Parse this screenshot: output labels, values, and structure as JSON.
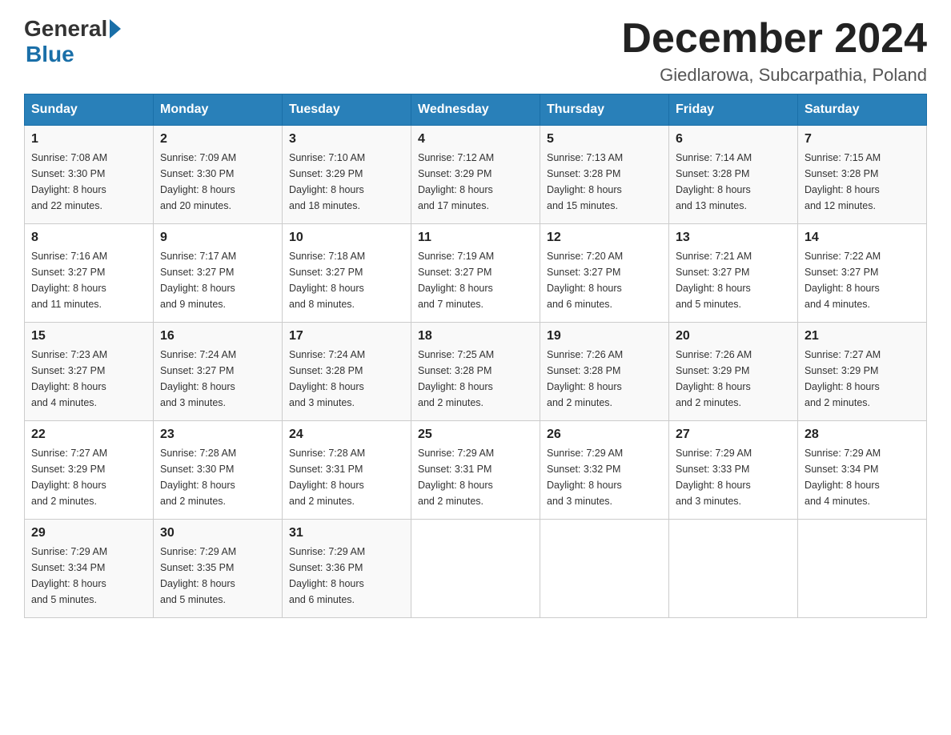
{
  "header": {
    "logo_general": "General",
    "logo_blue": "Blue",
    "month_title": "December 2024",
    "location": "Giedlarowa, Subcarpathia, Poland"
  },
  "weekdays": [
    "Sunday",
    "Monday",
    "Tuesday",
    "Wednesday",
    "Thursday",
    "Friday",
    "Saturday"
  ],
  "weeks": [
    [
      {
        "day": "1",
        "sunrise": "7:08 AM",
        "sunset": "3:30 PM",
        "daylight": "8 hours and 22 minutes."
      },
      {
        "day": "2",
        "sunrise": "7:09 AM",
        "sunset": "3:30 PM",
        "daylight": "8 hours and 20 minutes."
      },
      {
        "day": "3",
        "sunrise": "7:10 AM",
        "sunset": "3:29 PM",
        "daylight": "8 hours and 18 minutes."
      },
      {
        "day": "4",
        "sunrise": "7:12 AM",
        "sunset": "3:29 PM",
        "daylight": "8 hours and 17 minutes."
      },
      {
        "day": "5",
        "sunrise": "7:13 AM",
        "sunset": "3:28 PM",
        "daylight": "8 hours and 15 minutes."
      },
      {
        "day": "6",
        "sunrise": "7:14 AM",
        "sunset": "3:28 PM",
        "daylight": "8 hours and 13 minutes."
      },
      {
        "day": "7",
        "sunrise": "7:15 AM",
        "sunset": "3:28 PM",
        "daylight": "8 hours and 12 minutes."
      }
    ],
    [
      {
        "day": "8",
        "sunrise": "7:16 AM",
        "sunset": "3:27 PM",
        "daylight": "8 hours and 11 minutes."
      },
      {
        "day": "9",
        "sunrise": "7:17 AM",
        "sunset": "3:27 PM",
        "daylight": "8 hours and 9 minutes."
      },
      {
        "day": "10",
        "sunrise": "7:18 AM",
        "sunset": "3:27 PM",
        "daylight": "8 hours and 8 minutes."
      },
      {
        "day": "11",
        "sunrise": "7:19 AM",
        "sunset": "3:27 PM",
        "daylight": "8 hours and 7 minutes."
      },
      {
        "day": "12",
        "sunrise": "7:20 AM",
        "sunset": "3:27 PM",
        "daylight": "8 hours and 6 minutes."
      },
      {
        "day": "13",
        "sunrise": "7:21 AM",
        "sunset": "3:27 PM",
        "daylight": "8 hours and 5 minutes."
      },
      {
        "day": "14",
        "sunrise": "7:22 AM",
        "sunset": "3:27 PM",
        "daylight": "8 hours and 4 minutes."
      }
    ],
    [
      {
        "day": "15",
        "sunrise": "7:23 AM",
        "sunset": "3:27 PM",
        "daylight": "8 hours and 4 minutes."
      },
      {
        "day": "16",
        "sunrise": "7:24 AM",
        "sunset": "3:27 PM",
        "daylight": "8 hours and 3 minutes."
      },
      {
        "day": "17",
        "sunrise": "7:24 AM",
        "sunset": "3:28 PM",
        "daylight": "8 hours and 3 minutes."
      },
      {
        "day": "18",
        "sunrise": "7:25 AM",
        "sunset": "3:28 PM",
        "daylight": "8 hours and 2 minutes."
      },
      {
        "day": "19",
        "sunrise": "7:26 AM",
        "sunset": "3:28 PM",
        "daylight": "8 hours and 2 minutes."
      },
      {
        "day": "20",
        "sunrise": "7:26 AM",
        "sunset": "3:29 PM",
        "daylight": "8 hours and 2 minutes."
      },
      {
        "day": "21",
        "sunrise": "7:27 AM",
        "sunset": "3:29 PM",
        "daylight": "8 hours and 2 minutes."
      }
    ],
    [
      {
        "day": "22",
        "sunrise": "7:27 AM",
        "sunset": "3:29 PM",
        "daylight": "8 hours and 2 minutes."
      },
      {
        "day": "23",
        "sunrise": "7:28 AM",
        "sunset": "3:30 PM",
        "daylight": "8 hours and 2 minutes."
      },
      {
        "day": "24",
        "sunrise": "7:28 AM",
        "sunset": "3:31 PM",
        "daylight": "8 hours and 2 minutes."
      },
      {
        "day": "25",
        "sunrise": "7:29 AM",
        "sunset": "3:31 PM",
        "daylight": "8 hours and 2 minutes."
      },
      {
        "day": "26",
        "sunrise": "7:29 AM",
        "sunset": "3:32 PM",
        "daylight": "8 hours and 3 minutes."
      },
      {
        "day": "27",
        "sunrise": "7:29 AM",
        "sunset": "3:33 PM",
        "daylight": "8 hours and 3 minutes."
      },
      {
        "day": "28",
        "sunrise": "7:29 AM",
        "sunset": "3:34 PM",
        "daylight": "8 hours and 4 minutes."
      }
    ],
    [
      {
        "day": "29",
        "sunrise": "7:29 AM",
        "sunset": "3:34 PM",
        "daylight": "8 hours and 5 minutes."
      },
      {
        "day": "30",
        "sunrise": "7:29 AM",
        "sunset": "3:35 PM",
        "daylight": "8 hours and 5 minutes."
      },
      {
        "day": "31",
        "sunrise": "7:29 AM",
        "sunset": "3:36 PM",
        "daylight": "8 hours and 6 minutes."
      },
      null,
      null,
      null,
      null
    ]
  ],
  "labels": {
    "sunrise": "Sunrise:",
    "sunset": "Sunset:",
    "daylight": "Daylight:"
  }
}
